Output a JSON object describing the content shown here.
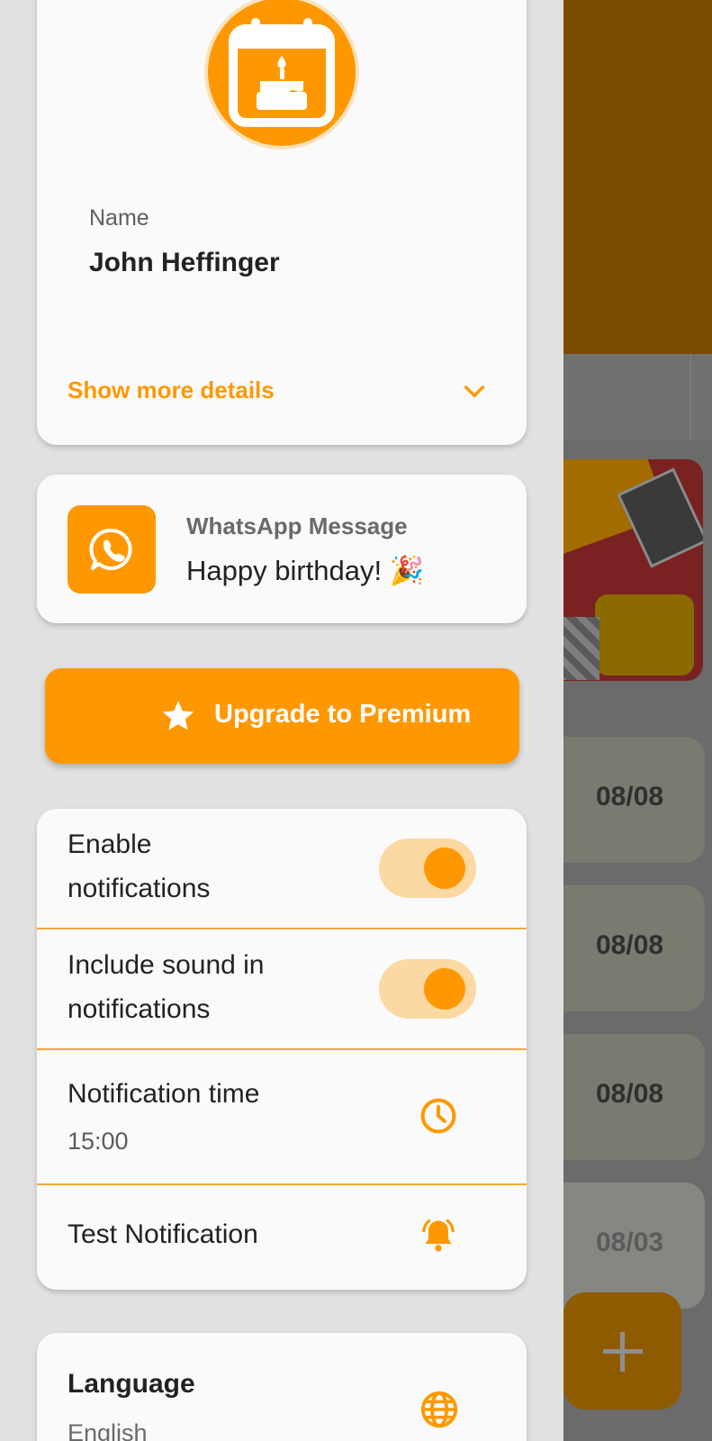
{
  "profile": {
    "name_label": "Name",
    "name_value": "John Heffinger",
    "show_more_label": "Show more details"
  },
  "whatsapp": {
    "title": "WhatsApp Message",
    "message": "Happy birthday! 🎉"
  },
  "premium": {
    "label": "Upgrade to Premium"
  },
  "settings": {
    "enable_notifications": {
      "label_line1": "Enable",
      "label_line2": "notifications",
      "enabled": true
    },
    "include_sound": {
      "label_line1": "Include sound in",
      "label_line2": "notifications",
      "enabled": true
    },
    "notification_time": {
      "label": "Notification time",
      "value": "15:00"
    },
    "test_notification": {
      "label": "Test Notification"
    }
  },
  "language": {
    "title": "Language",
    "value": "English"
  },
  "background": {
    "dates": [
      "08/08",
      "08/08",
      "08/08",
      "08/03"
    ]
  },
  "colors": {
    "accent": "#ff9800",
    "toggle_track": "#fcd9a2",
    "card_bg": "#fafafa",
    "drawer_bg": "#e1e1e1"
  }
}
